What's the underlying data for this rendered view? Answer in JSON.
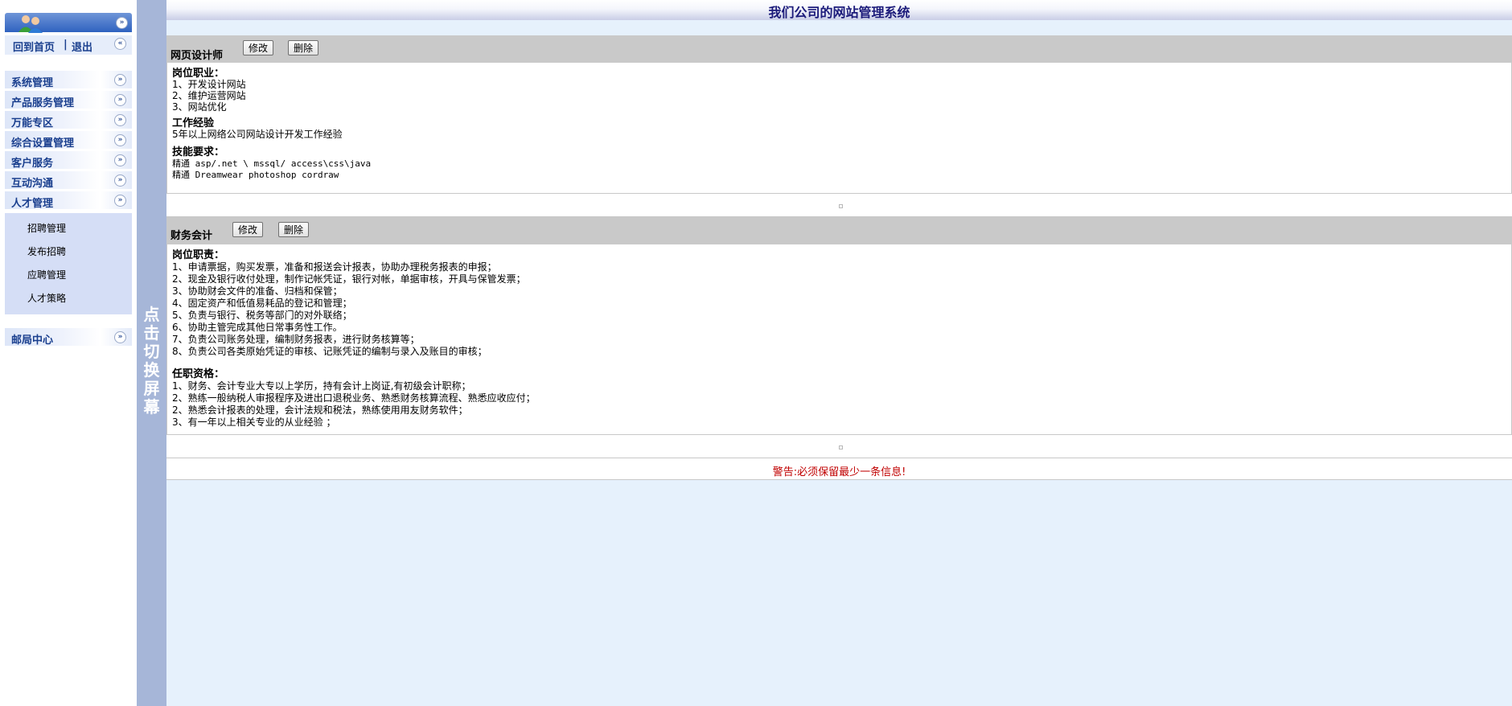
{
  "sidebar": {
    "quick_links": {
      "home": "回到首页",
      "separator": "|",
      "logout": "退出"
    },
    "menu": [
      {
        "label": "系统管理"
      },
      {
        "label": "产品服务管理"
      },
      {
        "label": "万能专区"
      },
      {
        "label": "综合设置管理"
      },
      {
        "label": "客户服务"
      },
      {
        "label": "互动沟通"
      },
      {
        "label": "人才管理"
      }
    ],
    "submenu": [
      {
        "label": "招聘管理"
      },
      {
        "label": "发布招聘"
      },
      {
        "label": "应聘管理"
      },
      {
        "label": "人才策略"
      }
    ],
    "mail": {
      "label": "邮局中心"
    }
  },
  "toggle": {
    "chars": [
      "点",
      "击",
      "切",
      "换",
      "屏",
      "幕"
    ]
  },
  "header": {
    "title": "我们公司的网站管理系统"
  },
  "jobs": [
    {
      "name": "网页设计师",
      "edit_label": "修改",
      "delete_label": "删除",
      "lines": [
        "岗位职业：",
        "1、开发设计网站",
        "2、维护运营网站",
        "3、网站优化",
        "工作经验",
        "5年以上网络公司网站设计开发工作经验",
        "技能要求：",
        "精通 asp/.net \\ mssql/ access\\css\\java",
        "精通 Dreamwear photoshop cordraw"
      ]
    },
    {
      "name": "财务会计",
      "edit_label": "修改",
      "delete_label": "删除",
      "lines": [
        "岗位职责：",
        "1、申请票据，购买发票，准备和报送会计报表，协助办理税务报表的申报；",
        "2、现金及银行收付处理，制作记帐凭证，银行对帐，单据审核，开具与保管发票；",
        "3、协助财会文件的准备、归档和保管；",
        "4、固定资产和低值易耗品的登记和管理；",
        "5、负责与银行、税务等部门的对外联络；",
        "6、协助主管完成其他日常事务性工作。",
        "7、负责公司账务处理，编制财务报表，进行财务核算等；",
        "8、负责公司各类原始凭证的审核、记账凭证的编制与录入及账目的审核；",
        "任职资格：",
        "1、财务、会计专业大专以上学历，持有会计上岗证,有初级会计职称；",
        "2、熟练一般纳税人审报程序及进出口退税业务、熟悉财务核算流程、熟悉应收应付；",
        "2、熟悉会计报表的处理，会计法规和税法，熟练使用用友财务软件；",
        "3、有一年以上相关专业的从业经验 ；"
      ]
    }
  ],
  "warning": "警告:必须保留最少一条信息!"
}
